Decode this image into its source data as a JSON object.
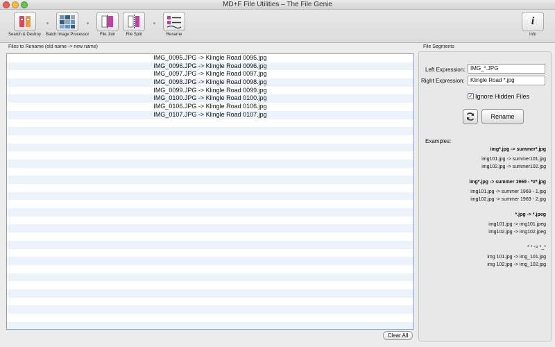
{
  "window": {
    "title": "MD+F File Utilities – The File Genie"
  },
  "toolbar": {
    "items": [
      {
        "label": "Search & Destroy"
      },
      {
        "label": "Batch Image Processor"
      },
      {
        "label": "File Join"
      },
      {
        "label": "File Split"
      },
      {
        "label": "Rename"
      }
    ],
    "info_label": "Info",
    "info_glyph": "i"
  },
  "files_panel": {
    "label": "Files to Rename (old name -> new name)",
    "rows": [
      "IMG_0095.JPG -> Klingle Road 0095.jpg",
      "IMG_0096.JPG -> Klingle Road 0096.jpg",
      "IMG_0097.JPG -> Klingle Road 0097.jpg",
      "IMG_0098.JPG -> Klingle Road 0098.jpg",
      "IMG_0099.JPG -> Klingle Road 0099.jpg",
      "IMG_0100.JPG -> Klingle Road 0100.jpg",
      "IMG_0106.JPG -> Klingle Road 0106.jpg",
      "IMG_0107.JPG -> Klingle Road 0107.jpg"
    ],
    "clear_all_label": "Clear All"
  },
  "segments_panel": {
    "label": "File Segments",
    "left_expression_label": "Left Expression:",
    "left_expression_value": "IMG_*.JPG",
    "right_expression_label": "Right Expression:",
    "right_expression_value": "Klingle Road *.jpg",
    "ignore_hidden_label": "Ignore Hidden Files",
    "ignore_hidden_checked": true,
    "rename_label": "Rename",
    "examples_label": "Examples:",
    "examples": [
      {
        "heading": "img*.jpg -> summer*.jpg",
        "lines": [
          "img101.jpg -> summer101.jpg",
          "img102.jpg -> summer102.jpg"
        ]
      },
      {
        "heading": "img*.jpg -> summer 1969 - *#*.jpg",
        "lines": [
          "img101.jpg -> summer 1969 - 1.jpg",
          "img102.jpg -> summer 1969 - 2.jpg"
        ]
      },
      {
        "heading": "*.jpg -> *.jpeg",
        "lines": [
          "img101.jpg -> img101.jpeg",
          "img102.jpg -> img102.jpeg"
        ]
      },
      {
        "heading": "* * -> *_*",
        "lines": [
          "img 101.jpg -> img_101.jpg",
          "img 102.jpg -> img_102.jpg"
        ]
      }
    ]
  },
  "colors": {
    "row_stripe": "#edf3fb",
    "list_border": "#8c9fb8",
    "icon_accent": "#c23fa6"
  },
  "icons": [
    "search-destroy-icon",
    "batch-image-icon",
    "file-join-icon",
    "file-split-icon",
    "rename-icon",
    "info-icon",
    "refresh-icon",
    "checkmark-icon"
  ]
}
